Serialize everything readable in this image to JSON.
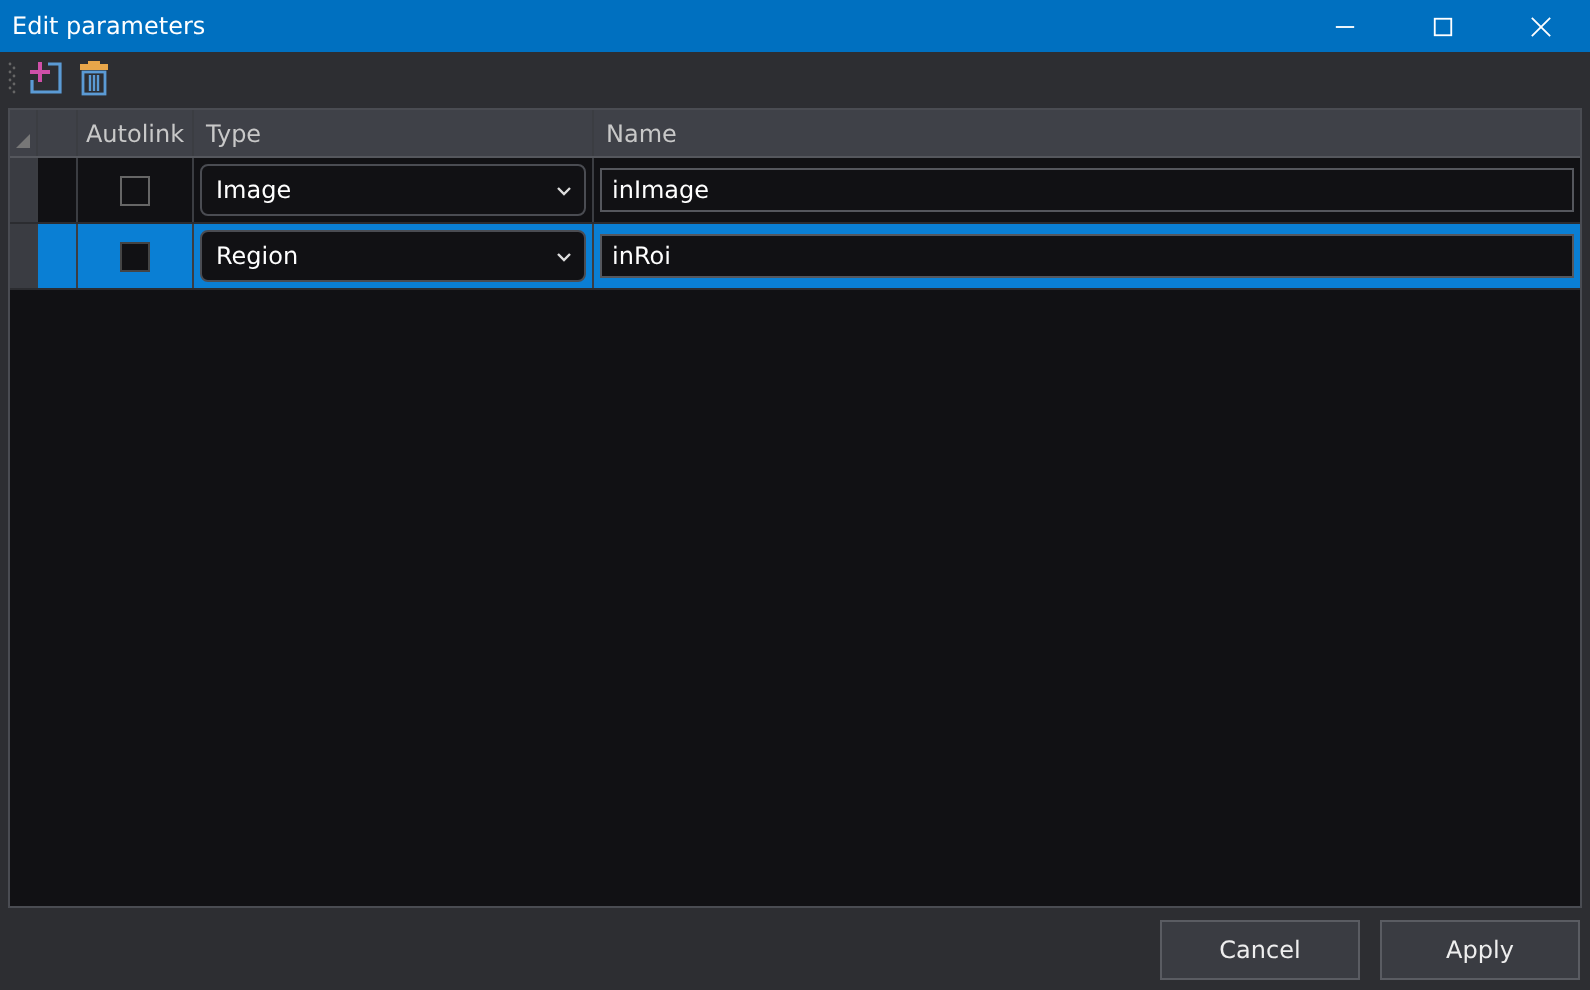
{
  "window": {
    "title": "Edit parameters"
  },
  "table": {
    "columns": [
      "Autolink",
      "Type",
      "Name"
    ],
    "rows": [
      {
        "selected": false,
        "autolink": false,
        "type": "Image",
        "name": "inImage"
      },
      {
        "selected": true,
        "autolink": false,
        "type": "Region",
        "name": "inRoi"
      }
    ]
  },
  "buttons": [
    "Cancel",
    "Apply"
  ]
}
